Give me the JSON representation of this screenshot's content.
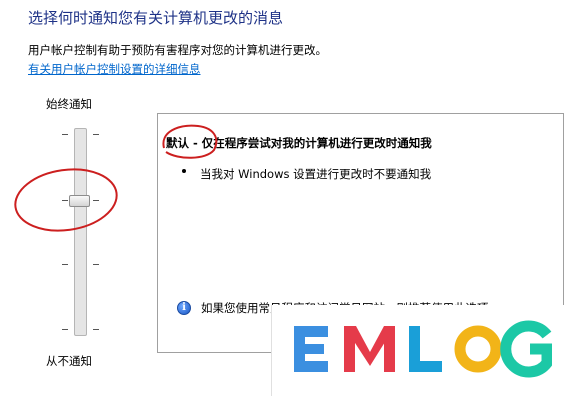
{
  "header": {
    "title": "选择何时通知您有关计算机更改的消息",
    "description": "用户帐户控制有助于预防有害程序对您的计算机进行更改。",
    "link": "有关用户帐户控制设置的详细信息"
  },
  "slider": {
    "top_label": "始终通知",
    "bottom_label": "从不通知",
    "level_index": 1,
    "level_count": 4
  },
  "setting_panel": {
    "title": "默认 - 仅在程序尝试对我的计算机进行更改时通知我",
    "bullet": "当我对 Windows 设置进行更改时不要通知我",
    "info_icon": "info-icon",
    "info_text": "如果您使用常见程序和访问常见网站，则推荐使用此选项。"
  },
  "watermark": {
    "logo_text": "EMLOG",
    "colors": [
      "#3b8fe0",
      "#e53b4a",
      "#1a9fd8",
      "#f2b418",
      "#1cc8a6"
    ]
  },
  "annotation_color": "#cc1f1f"
}
